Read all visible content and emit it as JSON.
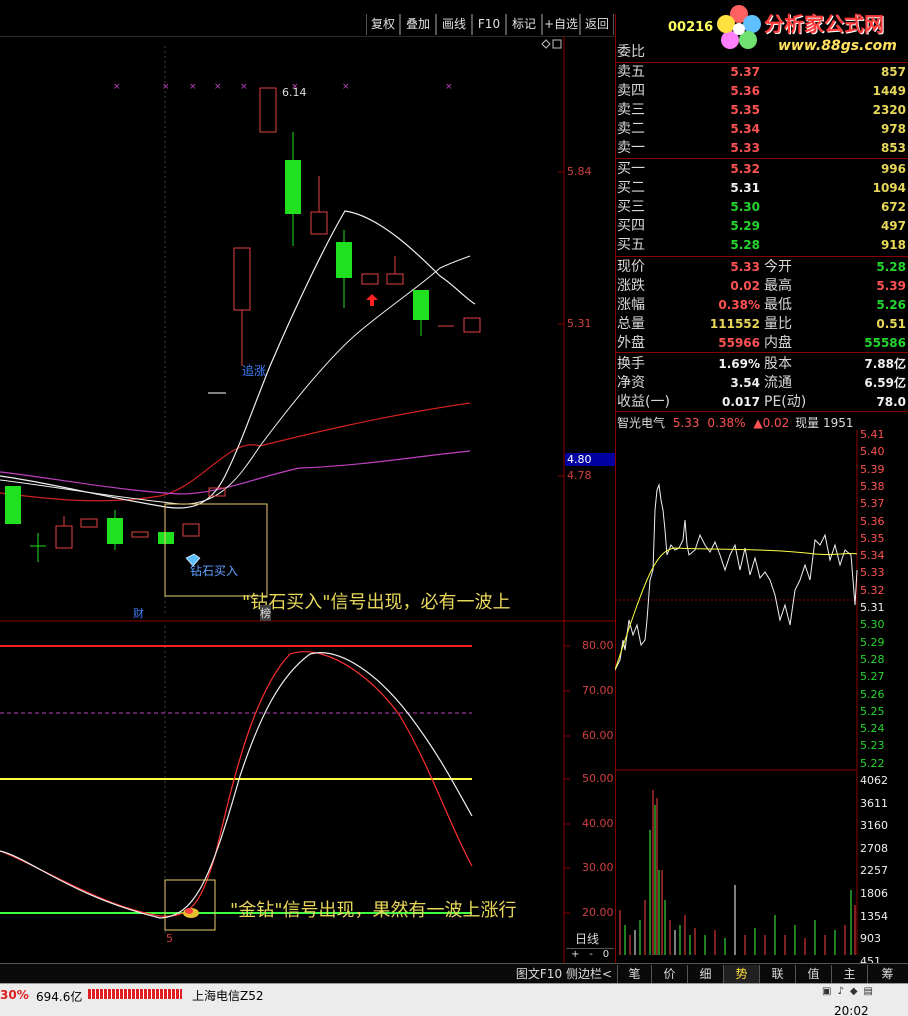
{
  "toolbar": {
    "buttons": [
      "复权",
      "叠加",
      "画线",
      "F10",
      "标记",
      "+自选",
      "返回"
    ]
  },
  "stock": {
    "code": "00216",
    "name": "智光电气",
    "ratio_label": "委比"
  },
  "logo": {
    "text": "分析家公式网",
    "url": "www.88gs.com"
  },
  "orderbook": {
    "sell": [
      {
        "label": "卖五",
        "price": "5.37",
        "vol": "857"
      },
      {
        "label": "卖四",
        "price": "5.36",
        "vol": "1449"
      },
      {
        "label": "卖三",
        "price": "5.35",
        "vol": "2320"
      },
      {
        "label": "卖二",
        "price": "5.34",
        "vol": "978"
      },
      {
        "label": "卖一",
        "price": "5.33",
        "vol": "853"
      }
    ],
    "buy": [
      {
        "label": "买一",
        "price": "5.32",
        "vol": "996"
      },
      {
        "label": "买二",
        "price": "5.31",
        "vol": "1094"
      },
      {
        "label": "买三",
        "price": "5.30",
        "vol": "672"
      },
      {
        "label": "买四",
        "price": "5.29",
        "vol": "497"
      },
      {
        "label": "买五",
        "price": "5.28",
        "vol": "918"
      }
    ]
  },
  "quote": {
    "rows": [
      {
        "l1": "现价",
        "v1": "5.33",
        "l2": "今开",
        "v2": "5.28"
      },
      {
        "l1": "涨跌",
        "v1": "0.02",
        "l2": "最高",
        "v2": "5.39"
      },
      {
        "l1": "涨幅",
        "v1": "0.38%",
        "l2": "最低",
        "v2": "5.26"
      },
      {
        "l1": "总量",
        "v1": "111552",
        "l2": "量比",
        "v2": "0.51"
      },
      {
        "l1": "外盘",
        "v1": "55966",
        "l2": "内盘",
        "v2": "55586"
      }
    ],
    "rows2": [
      {
        "l1": "换手",
        "v1": "1.69%",
        "l2": "股本",
        "v2": "7.88亿"
      },
      {
        "l1": "净资",
        "v1": "3.54",
        "l2": "流通",
        "v2": "6.59亿"
      },
      {
        "l1": "收益(一)",
        "v1": "0.017",
        "l2": "PE(动)",
        "v2": "78.0"
      }
    ]
  },
  "intraday_header": {
    "name": "智光电气",
    "price": "5.33",
    "pct": "0.38%",
    "chg": "▲0.02",
    "vol_label": "现量",
    "vol": "1951"
  },
  "price_axis": [
    "5.41",
    "5.40",
    "5.39",
    "5.38",
    "5.37",
    "5.36",
    "5.35",
    "5.34",
    "5.33",
    "5.32",
    "5.31",
    "5.30",
    "5.29",
    "5.28",
    "5.27",
    "5.26",
    "5.25",
    "5.24",
    "5.23",
    "5.22"
  ],
  "vol_axis": [
    "4062",
    "3611",
    "3160",
    "2708",
    "2257",
    "1806",
    "1354",
    "903",
    "451"
  ],
  "kline": {
    "high_label": "6.14",
    "axis": [
      "5.84",
      "5.31",
      "4.80",
      "4.78"
    ],
    "chase_label": "追涨",
    "diamond_label": "钻石买入",
    "caption1": "\"钻石买入\"信号出现，必有一波上",
    "cai_label": "财",
    "bang_label": "榜"
  },
  "indicator": {
    "axis": [
      "80.00",
      "70.00",
      "60.00",
      "50.00",
      "40.00",
      "30.00",
      "20.00"
    ],
    "caption2": "\"金钻\"信号出现，果然有一波上涨行",
    "five_label": "5",
    "period": "日线"
  },
  "bottom_tabs": [
    "图文F10",
    "侧边栏<",
    "笔",
    "价",
    "细",
    "势",
    "联",
    "值",
    "主",
    "筹"
  ],
  "status": {
    "pct": "30%",
    "amount": "694.6亿",
    "ticker": "上海电信Z52",
    "time": "20:02"
  },
  "colors": {
    "up": "#ff3030",
    "down": "#00ff00",
    "grid": "#800000",
    "accent": "#e8d85a"
  }
}
